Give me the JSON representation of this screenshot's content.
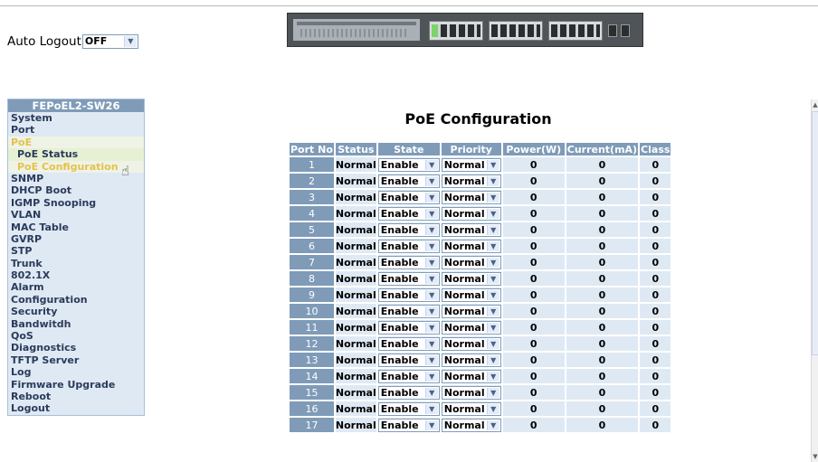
{
  "auto_logout": {
    "label": "Auto Logout",
    "value": "OFF"
  },
  "sidebar": {
    "device_name": "FEPoEL2-SW26",
    "items": [
      {
        "label": "System"
      },
      {
        "label": "Port"
      },
      {
        "label": "PoE"
      },
      {
        "label": "PoE Status"
      },
      {
        "label": "PoE Configuration"
      },
      {
        "label": "SNMP"
      },
      {
        "label": "DHCP Boot"
      },
      {
        "label": "IGMP Snooping"
      },
      {
        "label": "VLAN"
      },
      {
        "label": "MAC Table"
      },
      {
        "label": "GVRP"
      },
      {
        "label": "STP"
      },
      {
        "label": "Trunk"
      },
      {
        "label": "802.1X"
      },
      {
        "label": "Alarm"
      },
      {
        "label": "Configuration"
      },
      {
        "label": "Security"
      },
      {
        "label": "Bandwitdh"
      },
      {
        "label": "QoS"
      },
      {
        "label": "Diagnostics"
      },
      {
        "label": "TFTP Server"
      },
      {
        "label": "Log"
      },
      {
        "label": "Firmware Upgrade"
      },
      {
        "label": "Reboot"
      },
      {
        "label": "Logout"
      }
    ]
  },
  "page_title": "PoE Configuration",
  "table": {
    "headers": [
      "Port No",
      "Status",
      "State",
      "Priority",
      "Power(W)",
      "Current(mA)",
      "Class"
    ],
    "rows": [
      {
        "port": "1",
        "status": "Normal",
        "state": "Enable",
        "priority": "Normal",
        "power": "0",
        "current": "0",
        "class": "0"
      },
      {
        "port": "2",
        "status": "Normal",
        "state": "Enable",
        "priority": "Normal",
        "power": "0",
        "current": "0",
        "class": "0"
      },
      {
        "port": "3",
        "status": "Normal",
        "state": "Enable",
        "priority": "Normal",
        "power": "0",
        "current": "0",
        "class": "0"
      },
      {
        "port": "4",
        "status": "Normal",
        "state": "Enable",
        "priority": "Normal",
        "power": "0",
        "current": "0",
        "class": "0"
      },
      {
        "port": "5",
        "status": "Normal",
        "state": "Enable",
        "priority": "Normal",
        "power": "0",
        "current": "0",
        "class": "0"
      },
      {
        "port": "6",
        "status": "Normal",
        "state": "Enable",
        "priority": "Normal",
        "power": "0",
        "current": "0",
        "class": "0"
      },
      {
        "port": "7",
        "status": "Normal",
        "state": "Enable",
        "priority": "Normal",
        "power": "0",
        "current": "0",
        "class": "0"
      },
      {
        "port": "8",
        "status": "Normal",
        "state": "Enable",
        "priority": "Normal",
        "power": "0",
        "current": "0",
        "class": "0"
      },
      {
        "port": "9",
        "status": "Normal",
        "state": "Enable",
        "priority": "Normal",
        "power": "0",
        "current": "0",
        "class": "0"
      },
      {
        "port": "10",
        "status": "Normal",
        "state": "Enable",
        "priority": "Normal",
        "power": "0",
        "current": "0",
        "class": "0"
      },
      {
        "port": "11",
        "status": "Normal",
        "state": "Enable",
        "priority": "Normal",
        "power": "0",
        "current": "0",
        "class": "0"
      },
      {
        "port": "12",
        "status": "Normal",
        "state": "Enable",
        "priority": "Normal",
        "power": "0",
        "current": "0",
        "class": "0"
      },
      {
        "port": "13",
        "status": "Normal",
        "state": "Enable",
        "priority": "Normal",
        "power": "0",
        "current": "0",
        "class": "0"
      },
      {
        "port": "14",
        "status": "Normal",
        "state": "Enable",
        "priority": "Normal",
        "power": "0",
        "current": "0",
        "class": "0"
      },
      {
        "port": "15",
        "status": "Normal",
        "state": "Enable",
        "priority": "Normal",
        "power": "0",
        "current": "0",
        "class": "0"
      },
      {
        "port": "16",
        "status": "Normal",
        "state": "Enable",
        "priority": "Normal",
        "power": "0",
        "current": "0",
        "class": "0"
      },
      {
        "port": "17",
        "status": "Normal",
        "state": "Enable",
        "priority": "Normal",
        "power": "0",
        "current": "0",
        "class": "0"
      }
    ]
  },
  "icons": {
    "dropdown": "chevron-down-icon",
    "cursor": "hand-pointer-icon"
  },
  "colors": {
    "header_bg": "#7f9bb8",
    "cell_bg": "#dfe9f3",
    "active_menu": "#e3c24c"
  }
}
